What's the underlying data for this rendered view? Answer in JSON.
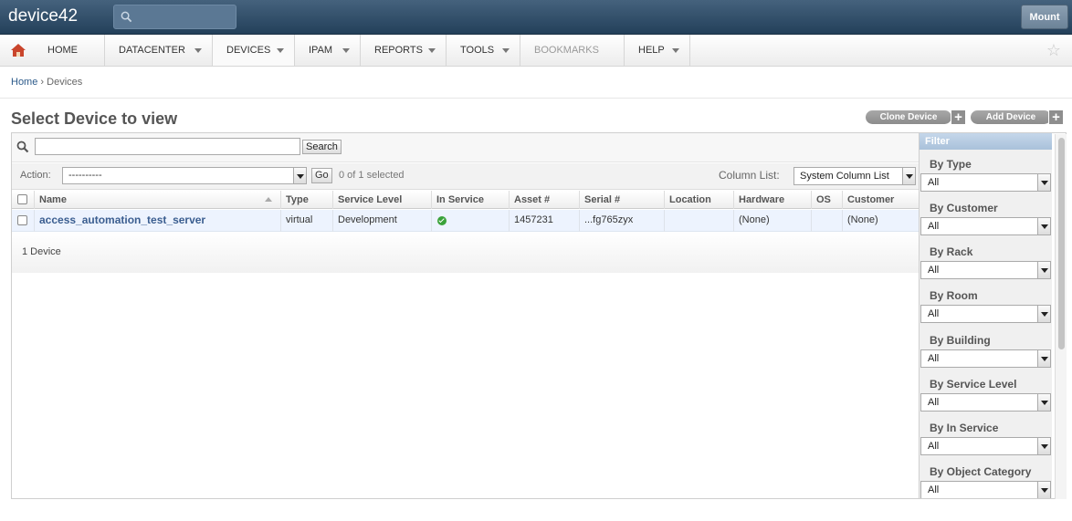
{
  "app": {
    "logo": "device42",
    "mount_label": "Mount"
  },
  "nav": {
    "items": [
      {
        "label": "HOME"
      },
      {
        "label": "DATACENTER"
      },
      {
        "label": "DEVICES"
      },
      {
        "label": "IPAM"
      },
      {
        "label": "REPORTS"
      },
      {
        "label": "TOOLS"
      },
      {
        "label": "BOOKMARKS"
      },
      {
        "label": "HELP"
      }
    ]
  },
  "breadcrumb": {
    "home": "Home",
    "separator": "›",
    "current": "Devices"
  },
  "page": {
    "title": "Select Device to view",
    "clone_label": "Clone Device",
    "add_label": "Add Device",
    "plus": "+"
  },
  "search": {
    "value": "",
    "button": "Search"
  },
  "actions": {
    "label": "Action:",
    "selected": "----------",
    "go": "Go",
    "count": "0 of 1 selected",
    "column_list_label": "Column List:",
    "column_list_value": "System Column List"
  },
  "table": {
    "headers": [
      "Name",
      "Type",
      "Service Level",
      "In Service",
      "Asset #",
      "Serial #",
      "Location",
      "Hardware",
      "OS",
      "Customer"
    ],
    "rows": [
      {
        "name": "access_automation_test_server",
        "type": "virtual",
        "service_level": "Development",
        "asset": "1457231",
        "serial": "...fg765zyx",
        "location": "",
        "hardware": "(None)",
        "os": "",
        "customer": "(None)"
      }
    ],
    "footer": "1 Device"
  },
  "filter": {
    "title": "Filter",
    "groups": [
      {
        "label": "By Type",
        "value": "All"
      },
      {
        "label": "By Customer",
        "value": "All"
      },
      {
        "label": "By Rack",
        "value": "All"
      },
      {
        "label": "By Room",
        "value": "All"
      },
      {
        "label": "By Building",
        "value": "All"
      },
      {
        "label": "By Service Level",
        "value": "All"
      },
      {
        "label": "By In Service",
        "value": "All"
      },
      {
        "label": "By Object Category",
        "value": "All"
      }
    ]
  }
}
